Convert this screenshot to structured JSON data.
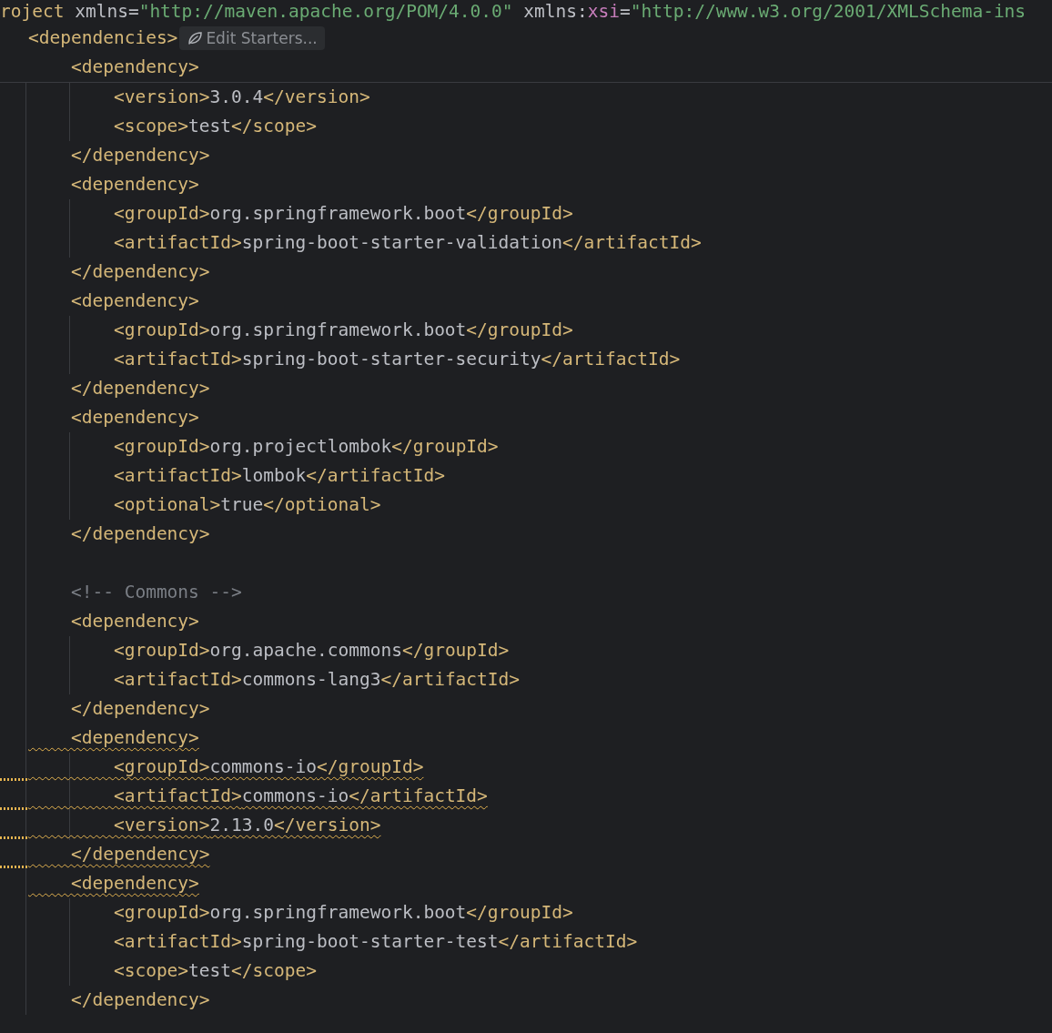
{
  "header_lines": [
    {
      "segments": [
        {
          "kind": "tag",
          "text": "roject "
        },
        {
          "kind": "attr",
          "text": "xmlns"
        },
        {
          "kind": "plain",
          "text": "="
        },
        {
          "kind": "string",
          "text": "\"http://maven.apache.org/POM/4.0.0\" "
        },
        {
          "kind": "attr",
          "text": "xmlns:"
        },
        {
          "kind": "ns",
          "text": "xsi"
        },
        {
          "kind": "plain",
          "text": "="
        },
        {
          "kind": "string",
          "text": "\"http://www.w3.org/2001/XMLSchema-ins"
        }
      ]
    },
    {
      "segments": [
        {
          "kind": "tag",
          "text": "<dependencies>"
        }
      ],
      "hint": "Edit Starters..."
    },
    {
      "segments": [
        {
          "kind": "tag",
          "text": "    <dependency>"
        }
      ]
    }
  ],
  "lines": [
    {
      "kind": "code",
      "segments": [
        {
          "kind": "tag",
          "text": "        <version>"
        },
        {
          "kind": "value",
          "text": "3.0.4"
        },
        {
          "kind": "tag",
          "text": "</version>"
        }
      ]
    },
    {
      "kind": "code",
      "segments": [
        {
          "kind": "tag",
          "text": "        <scope>"
        },
        {
          "kind": "value",
          "text": "test"
        },
        {
          "kind": "tag",
          "text": "</scope>"
        }
      ]
    },
    {
      "kind": "code",
      "segments": [
        {
          "kind": "tag",
          "text": "    </dependency>"
        }
      ]
    },
    {
      "kind": "code",
      "segments": [
        {
          "kind": "tag",
          "text": "    <dependency>"
        }
      ]
    },
    {
      "kind": "code",
      "segments": [
        {
          "kind": "tag",
          "text": "        <groupId>"
        },
        {
          "kind": "value",
          "text": "org.springframework.boot"
        },
        {
          "kind": "tag",
          "text": "</groupId>"
        }
      ]
    },
    {
      "kind": "code",
      "segments": [
        {
          "kind": "tag",
          "text": "        <artifactId>"
        },
        {
          "kind": "value",
          "text": "spring-boot-starter-validation"
        },
        {
          "kind": "tag",
          "text": "</artifactId>"
        }
      ]
    },
    {
      "kind": "code",
      "segments": [
        {
          "kind": "tag",
          "text": "    </dependency>"
        }
      ]
    },
    {
      "kind": "code",
      "segments": [
        {
          "kind": "tag",
          "text": "    <dependency>"
        }
      ]
    },
    {
      "kind": "code",
      "segments": [
        {
          "kind": "tag",
          "text": "        <groupId>"
        },
        {
          "kind": "value",
          "text": "org.springframework.boot"
        },
        {
          "kind": "tag",
          "text": "</groupId>"
        }
      ]
    },
    {
      "kind": "code",
      "segments": [
        {
          "kind": "tag",
          "text": "        <artifactId>"
        },
        {
          "kind": "value",
          "text": "spring-boot-starter-security"
        },
        {
          "kind": "tag",
          "text": "</artifactId>"
        }
      ]
    },
    {
      "kind": "code",
      "segments": [
        {
          "kind": "tag",
          "text": "    </dependency>"
        }
      ]
    },
    {
      "kind": "code",
      "segments": [
        {
          "kind": "tag",
          "text": "    <dependency>"
        }
      ]
    },
    {
      "kind": "code",
      "segments": [
        {
          "kind": "tag",
          "text": "        <groupId>"
        },
        {
          "kind": "value",
          "text": "org.projectlombok"
        },
        {
          "kind": "tag",
          "text": "</groupId>"
        }
      ]
    },
    {
      "kind": "code",
      "segments": [
        {
          "kind": "tag",
          "text": "        <artifactId>"
        },
        {
          "kind": "value",
          "text": "lombok"
        },
        {
          "kind": "tag",
          "text": "</artifactId>"
        }
      ]
    },
    {
      "kind": "code",
      "segments": [
        {
          "kind": "tag",
          "text": "        <optional>"
        },
        {
          "kind": "value",
          "text": "true"
        },
        {
          "kind": "tag",
          "text": "</optional>"
        }
      ]
    },
    {
      "kind": "code",
      "segments": [
        {
          "kind": "tag",
          "text": "    </dependency>"
        }
      ]
    },
    {
      "kind": "blank"
    },
    {
      "kind": "code",
      "segments": [
        {
          "kind": "comment",
          "text": "    <!-- Commons -->"
        }
      ]
    },
    {
      "kind": "code",
      "segments": [
        {
          "kind": "tag",
          "text": "    <dependency>"
        }
      ]
    },
    {
      "kind": "code",
      "segments": [
        {
          "kind": "tag",
          "text": "        <groupId>"
        },
        {
          "kind": "value",
          "text": "org.apache.commons"
        },
        {
          "kind": "tag",
          "text": "</groupId>"
        }
      ]
    },
    {
      "kind": "code",
      "segments": [
        {
          "kind": "tag",
          "text": "        <artifactId>"
        },
        {
          "kind": "value",
          "text": "commons-lang3"
        },
        {
          "kind": "tag",
          "text": "</artifactId>"
        }
      ]
    },
    {
      "kind": "code",
      "segments": [
        {
          "kind": "tag",
          "text": "    </dependency>"
        }
      ]
    },
    {
      "kind": "warning",
      "segments": [
        {
          "kind": "tag",
          "text": "    <dependency>"
        }
      ]
    },
    {
      "kind": "warningline",
      "segments": [
        {
          "kind": "tag",
          "text": "        <groupId>"
        },
        {
          "kind": "value",
          "text": "commons-io"
        },
        {
          "kind": "tag",
          "text": "</groupId>"
        }
      ]
    },
    {
      "kind": "warningline",
      "segments": [
        {
          "kind": "tag",
          "text": "        <artifactId>"
        },
        {
          "kind": "value",
          "text": "commons-io"
        },
        {
          "kind": "tag",
          "text": "</artifactId>"
        }
      ]
    },
    {
      "kind": "warningline",
      "segments": [
        {
          "kind": "tag",
          "text": "        <version>"
        },
        {
          "kind": "value",
          "text": "2.13.0"
        },
        {
          "kind": "tag",
          "text": "</version>"
        }
      ]
    },
    {
      "kind": "warningline",
      "segments": [
        {
          "kind": "tag",
          "text": "    </dependency>"
        }
      ]
    },
    {
      "kind": "warning",
      "segments": [
        {
          "kind": "tag",
          "text": "    <dependency>"
        }
      ]
    },
    {
      "kind": "code",
      "segments": [
        {
          "kind": "tag",
          "text": "        <groupId>"
        },
        {
          "kind": "value",
          "text": "org.springframework.boot"
        },
        {
          "kind": "tag",
          "text": "</groupId>"
        }
      ]
    },
    {
      "kind": "code",
      "segments": [
        {
          "kind": "tag",
          "text": "        <artifactId>"
        },
        {
          "kind": "value",
          "text": "spring-boot-starter-test"
        },
        {
          "kind": "tag",
          "text": "</artifactId>"
        }
      ]
    },
    {
      "kind": "code",
      "segments": [
        {
          "kind": "tag",
          "text": "        <scope>"
        },
        {
          "kind": "value",
          "text": "test"
        },
        {
          "kind": "tag",
          "text": "</scope>"
        }
      ]
    },
    {
      "kind": "code",
      "segments": [
        {
          "kind": "tag",
          "text": "    </dependency>"
        }
      ]
    }
  ]
}
